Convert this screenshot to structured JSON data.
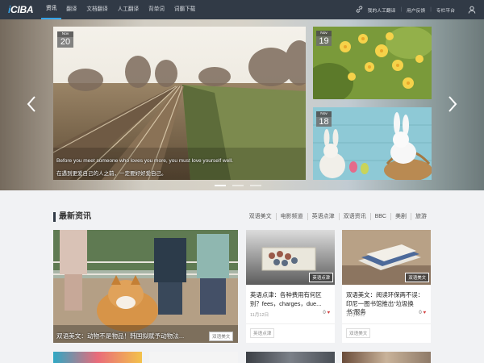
{
  "header": {
    "logo": "iCIBA",
    "nav": [
      {
        "label": "资讯",
        "active": true
      },
      {
        "label": "翻译",
        "active": false
      },
      {
        "label": "文档翻译",
        "active": false
      },
      {
        "label": "人工翻译",
        "active": false
      },
      {
        "label": "背单词",
        "active": false
      },
      {
        "label": "词霸下载",
        "active": false
      }
    ],
    "right_links": [
      "我的人工翻译",
      "用户反馈",
      "专栏平台"
    ],
    "icons": [
      "link-icon",
      "user-icon"
    ]
  },
  "carousel": {
    "main": {
      "month": "Nov",
      "day": "20",
      "caption_en": "Before you meet someone who loves you more, you must love yourself well.",
      "caption_zh": "在遇到更爱自己的人之前，一定要好好爱自己。"
    },
    "side": [
      {
        "month": "Nov",
        "day": "19"
      },
      {
        "month": "Nov",
        "day": "18"
      }
    ],
    "dots": 3,
    "active_dot": 0,
    "arrows": [
      "chevron-left-icon",
      "chevron-right-icon"
    ]
  },
  "news": {
    "section_title": "最新资讯",
    "categories": [
      "双语美文",
      "电影频道",
      "英语点津",
      "双语资讯",
      "BBC",
      "美剧",
      "旅游"
    ],
    "featured": {
      "title": "双语美文：动物不是物品！韩国拟赋予动物法...",
      "tag": "双语美文"
    },
    "cards": [
      {
        "image_tag": "英语点津",
        "title": "英语点津：各种费用有何区别？fees，charges，due...",
        "date": "11月12日",
        "likes": "0",
        "footer_tag": "英语点津"
      },
      {
        "image_tag": "双语美文",
        "title": "双语美文：阅读环保两不误：印尼一图书馆推出“垃圾换书”服务",
        "date": "11月12日",
        "likes": "0",
        "footer_tag": "双语美文"
      }
    ]
  }
}
